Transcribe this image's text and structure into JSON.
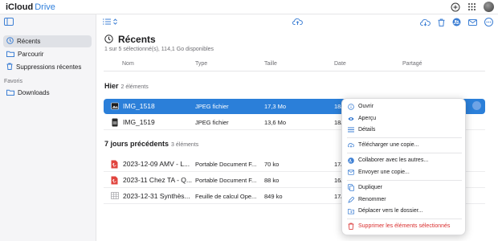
{
  "app": {
    "apple_glyph": "",
    "name": "iCloud",
    "product": "Drive"
  },
  "sidebar": {
    "items": [
      {
        "label": "Récents",
        "icon": "clock-icon"
      },
      {
        "label": "Parcourir",
        "icon": "folder-icon"
      },
      {
        "label": "Suppressions récentes",
        "icon": "trash-icon"
      }
    ],
    "favorites_heading": "Favoris",
    "favorites": [
      {
        "label": "Downloads",
        "icon": "folder-icon"
      }
    ]
  },
  "main": {
    "title": "Récents",
    "subtitle": "1 sur 5 sélectionné(s), 114,1 Go disponibles",
    "columns": {
      "name": "Nom",
      "kind": "Type",
      "size": "Taille",
      "date": "Date",
      "shared": "Partagé"
    },
    "groups": [
      {
        "label": "Hier",
        "count": "2 éléments"
      },
      {
        "label": "7 jours précédents",
        "count": "3 éléments"
      }
    ],
    "rows": [
      {
        "name": "IMG_1518",
        "kind": "JPEG fichier",
        "size": "17,3 Mo",
        "date": "18/"
      },
      {
        "name": "IMG_1519",
        "kind": "JPEG fichier",
        "size": "13,6 Mo",
        "date": "18/"
      },
      {
        "name": "2023-12-09 AMV - L...",
        "kind": "Portable Document F...",
        "size": "70 ko",
        "date": "17/"
      },
      {
        "name": "2023-11 Chez TA - Q...",
        "kind": "Portable Document F...",
        "size": "88 ko",
        "date": "16/"
      },
      {
        "name": "2023-12-31 Synthès...",
        "kind": "Feuille de calcul Ope...",
        "size": "849 ko",
        "date": "17/"
      }
    ]
  },
  "menu": {
    "items": [
      {
        "label": "Ouvrir",
        "icon": "info-icon"
      },
      {
        "label": "Aperçu",
        "icon": "eye-icon"
      },
      {
        "label": "Détails",
        "icon": "list-icon"
      },
      {
        "label": "Télécharger une copie...",
        "icon": "cloud-download-icon"
      },
      {
        "label": "Collaborer avec les autres...",
        "icon": "people-icon"
      },
      {
        "label": "Envoyer une copie...",
        "icon": "mail-icon"
      },
      {
        "label": "Dupliquer",
        "icon": "duplicate-icon"
      },
      {
        "label": "Renommer",
        "icon": "pencil-icon"
      },
      {
        "label": "Déplacer vers le dossier...",
        "icon": "folder-move-icon"
      },
      {
        "label": "Supprimer les éléments sélectionnés",
        "icon": "trash-icon"
      }
    ]
  },
  "colors": {
    "accent": "#2b7fd9",
    "danger": "#d92d2d",
    "sidebar_bg": "#f5f5f7"
  }
}
